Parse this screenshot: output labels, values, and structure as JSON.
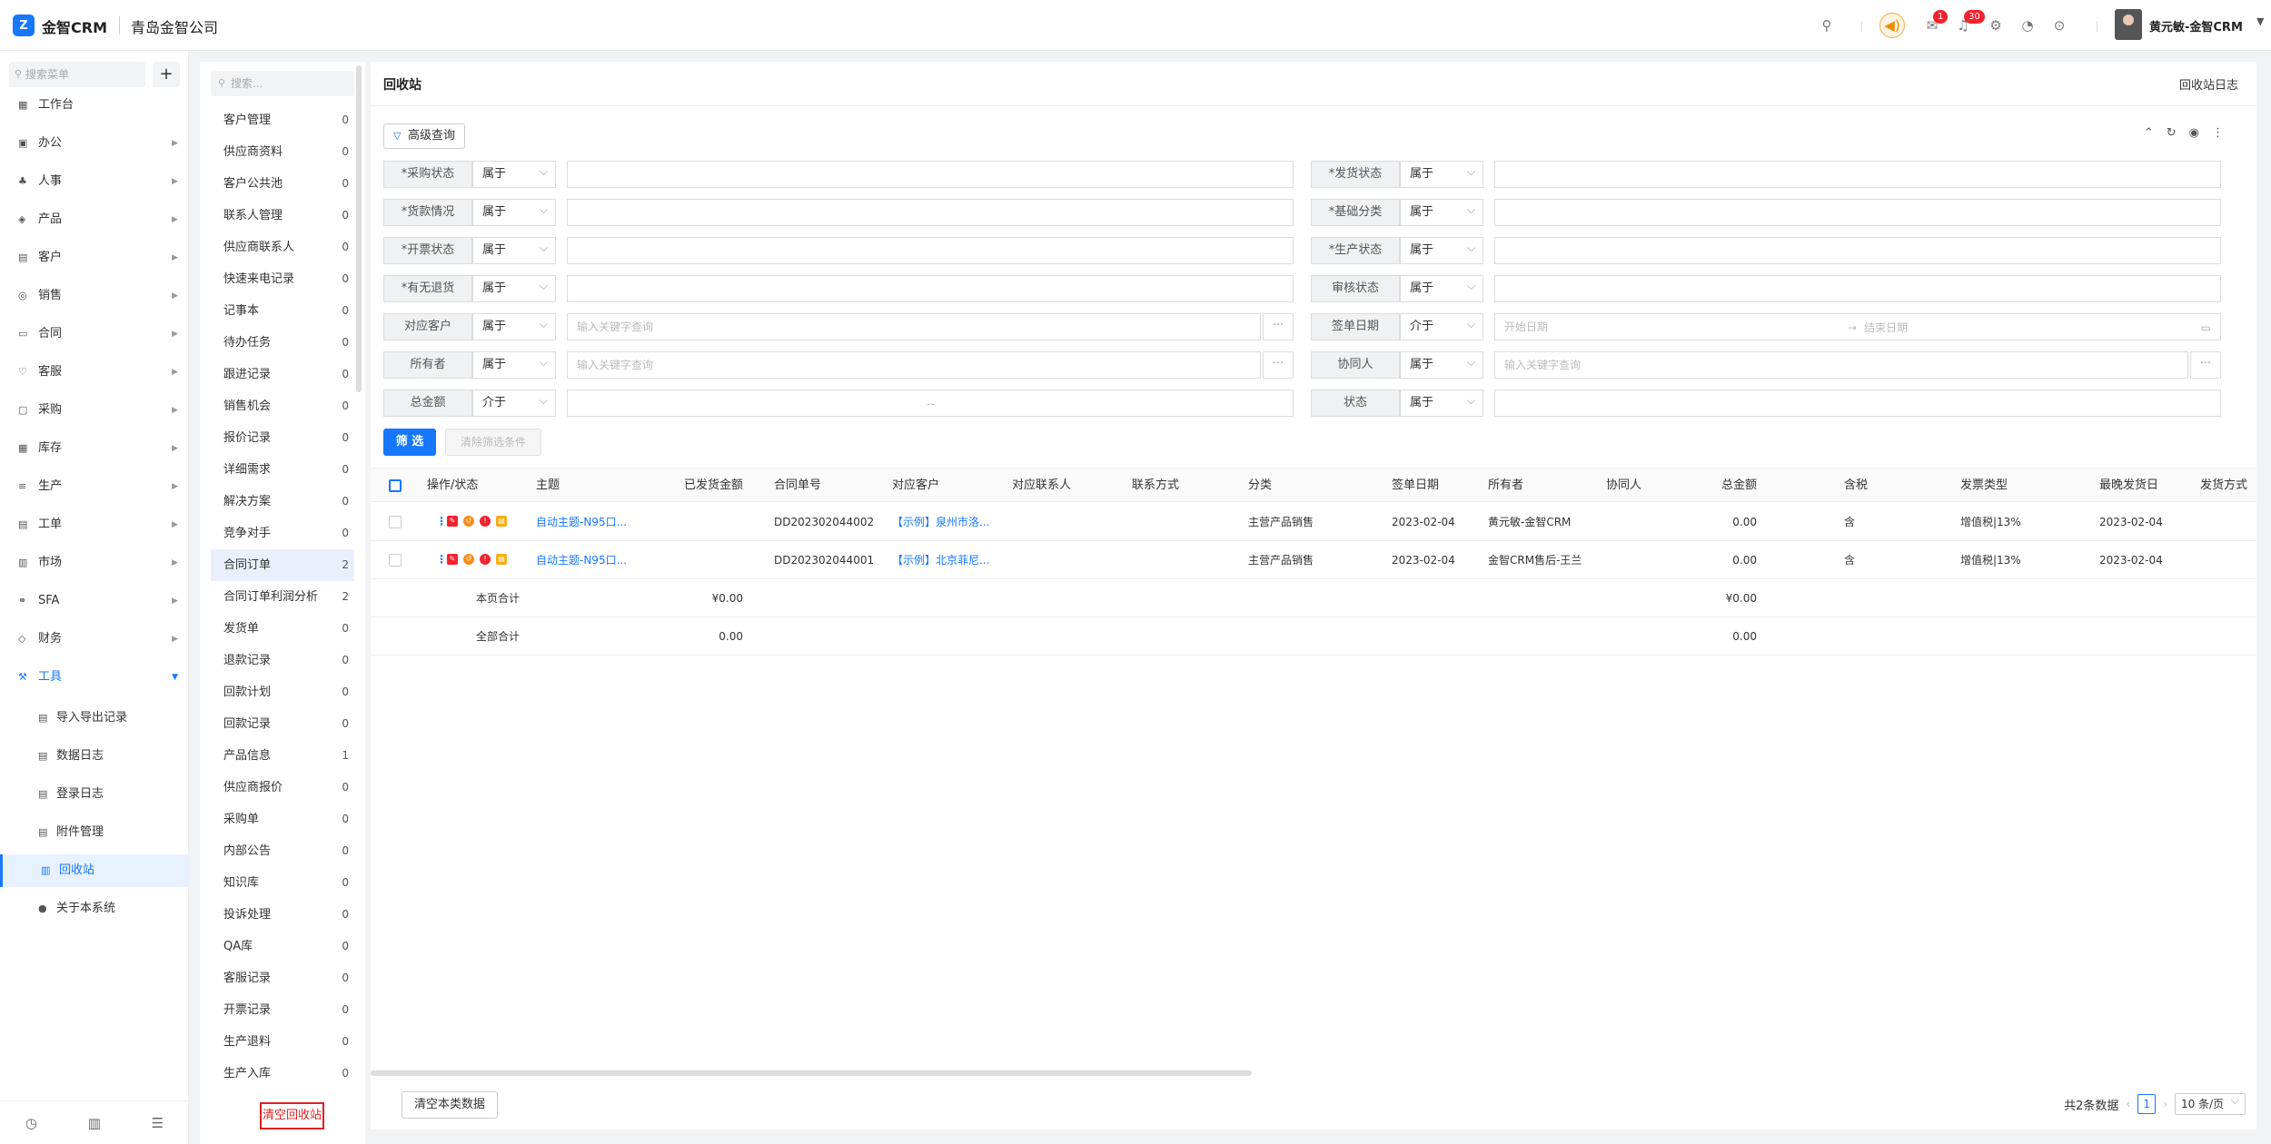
{
  "app": {
    "brand": "金智CRM",
    "logo_glyph": "Z",
    "company": "青岛金智公司",
    "user": "黄元敏-金智CRM",
    "badge_messages": "1",
    "badge_notices": "30"
  },
  "sidebar": {
    "search_placeholder": "搜索菜单",
    "items": [
      {
        "label": "工作台",
        "icon": "dashboard-icon"
      },
      {
        "label": "办公",
        "icon": "office-icon"
      },
      {
        "label": "人事",
        "icon": "person-icon"
      },
      {
        "label": "产品",
        "icon": "product-icon"
      },
      {
        "label": "客户",
        "icon": "customer-icon"
      },
      {
        "label": "销售",
        "icon": "sales-icon"
      },
      {
        "label": "合同",
        "icon": "contract-icon"
      },
      {
        "label": "客服",
        "icon": "service-icon"
      },
      {
        "label": "采购",
        "icon": "purchase-icon"
      },
      {
        "label": "库存",
        "icon": "stock-icon"
      },
      {
        "label": "生产",
        "icon": "production-icon"
      },
      {
        "label": "工单",
        "icon": "ticket-icon"
      },
      {
        "label": "市场",
        "icon": "market-icon"
      },
      {
        "label": "SFA",
        "icon": "sfa-icon"
      },
      {
        "label": "财务",
        "icon": "finance-icon"
      },
      {
        "label": "工具",
        "icon": "tools-icon"
      }
    ],
    "sub_items": [
      {
        "label": "导入导出记录"
      },
      {
        "label": "数据日志"
      },
      {
        "label": "登录日志"
      },
      {
        "label": "附件管理"
      },
      {
        "label": "回收站"
      },
      {
        "label": "关于本系统"
      }
    ]
  },
  "categories": {
    "search_placeholder": "搜索...",
    "items": [
      {
        "label": "客户管理",
        "count": "0"
      },
      {
        "label": "供应商资料",
        "count": "0"
      },
      {
        "label": "客户公共池",
        "count": "0"
      },
      {
        "label": "联系人管理",
        "count": "0"
      },
      {
        "label": "供应商联系人",
        "count": "0"
      },
      {
        "label": "快速来电记录",
        "count": "0"
      },
      {
        "label": "记事本",
        "count": "0"
      },
      {
        "label": "待办任务",
        "count": "0"
      },
      {
        "label": "跟进记录",
        "count": "0"
      },
      {
        "label": "销售机会",
        "count": "0"
      },
      {
        "label": "报价记录",
        "count": "0"
      },
      {
        "label": "详细需求",
        "count": "0"
      },
      {
        "label": "解决方案",
        "count": "0"
      },
      {
        "label": "竞争对手",
        "count": "0"
      },
      {
        "label": "合同订单",
        "count": "2"
      },
      {
        "label": "合同订单利润分析",
        "count": "2"
      },
      {
        "label": "发货单",
        "count": "0"
      },
      {
        "label": "退款记录",
        "count": "0"
      },
      {
        "label": "回款计划",
        "count": "0"
      },
      {
        "label": "回款记录",
        "count": "0"
      },
      {
        "label": "产品信息",
        "count": "1"
      },
      {
        "label": "供应商报价",
        "count": "0"
      },
      {
        "label": "采购单",
        "count": "0"
      },
      {
        "label": "内部公告",
        "count": "0"
      },
      {
        "label": "知识库",
        "count": "0"
      },
      {
        "label": "投诉处理",
        "count": "0"
      },
      {
        "label": "QA库",
        "count": "0"
      },
      {
        "label": "客服记录",
        "count": "0"
      },
      {
        "label": "开票记录",
        "count": "0"
      },
      {
        "label": "生产退料",
        "count": "0"
      },
      {
        "label": "生产入库",
        "count": "0"
      }
    ],
    "clear_bin": "清空回收站"
  },
  "main": {
    "title": "回收站",
    "log_link": "回收站日志",
    "advanced_query": "高级查询",
    "filters_left": [
      {
        "label": "*采购状态",
        "op": "属于",
        "placeholder": ""
      },
      {
        "label": "*货款情况",
        "op": "属于",
        "placeholder": ""
      },
      {
        "label": "*开票状态",
        "op": "属于",
        "placeholder": ""
      },
      {
        "label": "*有无退货",
        "op": "属于",
        "placeholder": ""
      },
      {
        "label": "对应客户",
        "op": "属于",
        "placeholder": "输入关键字查询"
      },
      {
        "label": "所有者",
        "op": "属于",
        "placeholder": "输入关键字查询"
      },
      {
        "label": "总金额",
        "op": "介于",
        "placeholder": "--"
      }
    ],
    "filters_right": [
      {
        "label": "*发货状态",
        "op": "属于",
        "placeholder": ""
      },
      {
        "label": "*基础分类",
        "op": "属于",
        "placeholder": ""
      },
      {
        "label": "*生产状态",
        "op": "属于",
        "placeholder": ""
      },
      {
        "label": "审核状态",
        "op": "属于",
        "placeholder": ""
      },
      {
        "label": "签单日期",
        "op": "介于",
        "placeholder": "开始日期",
        "placeholder2": "结束日期"
      },
      {
        "label": "协同人",
        "op": "属于",
        "placeholder": "输入关键字查询"
      },
      {
        "label": "状态",
        "op": "属于",
        "placeholder": ""
      }
    ],
    "filter_btn": "筛 选",
    "clear_filter_btn": "清除筛选条件",
    "columns": [
      "操作/状态",
      "主题",
      "已发货金额",
      "合同单号",
      "对应客户",
      "对应联系人",
      "联系方式",
      "分类",
      "签单日期",
      "所有者",
      "协同人",
      "总金额",
      "含税",
      "发票类型",
      "最晚发货日",
      "发货方式"
    ],
    "rows": [
      {
        "subject": "自动主题-N95口...",
        "shipped": "",
        "contract_no": "DD202302044002",
        "customer": "【示例】泉州市洛...",
        "contact": "",
        "phone": "",
        "category": "主营产品销售",
        "sign_date": "2023-02-04",
        "owner": "黄元敏-金智CRM",
        "collab": "",
        "total": "0.00",
        "tax": "含",
        "invoice": "增值税|13%",
        "latest_ship": "2023-02-04",
        "ship_method": ""
      },
      {
        "subject": "自动主题-N95口...",
        "shipped": "",
        "contract_no": "DD202302044001",
        "customer": "【示例】北京菲尼...",
        "contact": "",
        "phone": "",
        "category": "主营产品销售",
        "sign_date": "2023-02-04",
        "owner": "金智CRM售后-王兰",
        "collab": "",
        "total": "0.00",
        "tax": "含",
        "invoice": "增值税|13%",
        "latest_ship": "2023-02-04",
        "ship_method": ""
      }
    ],
    "summary": [
      {
        "label": "本页合计",
        "shipped": "¥0.00",
        "total": "¥0.00"
      },
      {
        "label": "全部合计",
        "shipped": "0.00",
        "total": "0.00"
      }
    ],
    "clear_type_btn": "清空本类数据",
    "pager": {
      "total_text": "共2条数据",
      "current_page": "1",
      "page_size": "10 条/页"
    }
  }
}
